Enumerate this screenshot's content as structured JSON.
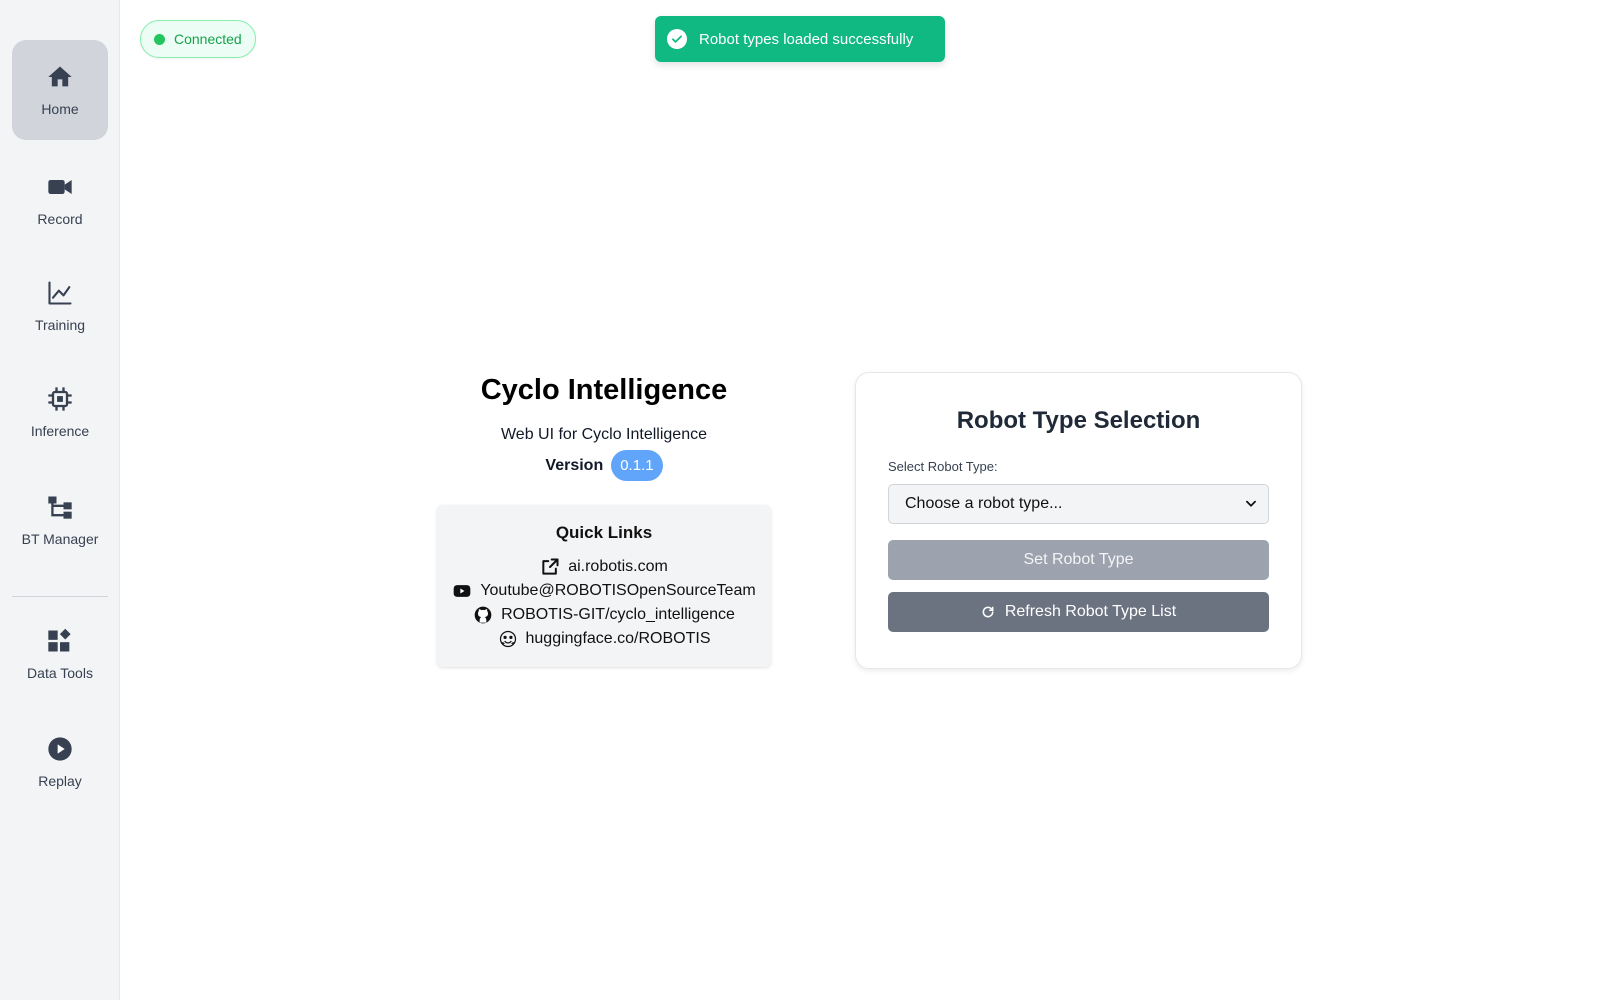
{
  "sidebar": {
    "items": [
      {
        "label": "Home",
        "icon": "home-icon",
        "active": true
      },
      {
        "label": "Record",
        "icon": "video-camera-icon",
        "active": false
      },
      {
        "label": "Training",
        "icon": "line-chart-icon",
        "active": false
      },
      {
        "label": "Inference",
        "icon": "cpu-chip-icon",
        "active": false
      },
      {
        "label": "BT Manager",
        "icon": "tree-structure-icon",
        "active": false
      },
      {
        "label": "Data Tools",
        "icon": "widgets-icon",
        "active": false
      },
      {
        "label": "Replay",
        "icon": "play-circle-icon",
        "active": false
      }
    ]
  },
  "status": {
    "label": "Connected",
    "color": "#16a34a"
  },
  "toast": {
    "message": "Robot types loaded successfully",
    "color": "#10b981"
  },
  "info": {
    "title": "Cyclo Intelligence",
    "subtitle": "Web UI for Cyclo Intelligence",
    "version_label": "Version",
    "version": "0.1.1"
  },
  "quick_links": {
    "title": "Quick Links",
    "links": [
      {
        "label": "ai.robotis.com",
        "icon": "external-link-icon"
      },
      {
        "label": "Youtube@ROBOTISOpenSourceTeam",
        "icon": "youtube-icon"
      },
      {
        "label": "ROBOTIS-GIT/cyclo_intelligence",
        "icon": "github-icon"
      },
      {
        "label": "huggingface.co/ROBOTIS",
        "icon": "huggingface-icon"
      }
    ]
  },
  "robot_card": {
    "title": "Robot Type Selection",
    "select_label": "Select Robot Type:",
    "select_value": "Choose a robot type...",
    "set_button": "Set Robot Type",
    "refresh_button": "Refresh Robot Type List"
  }
}
